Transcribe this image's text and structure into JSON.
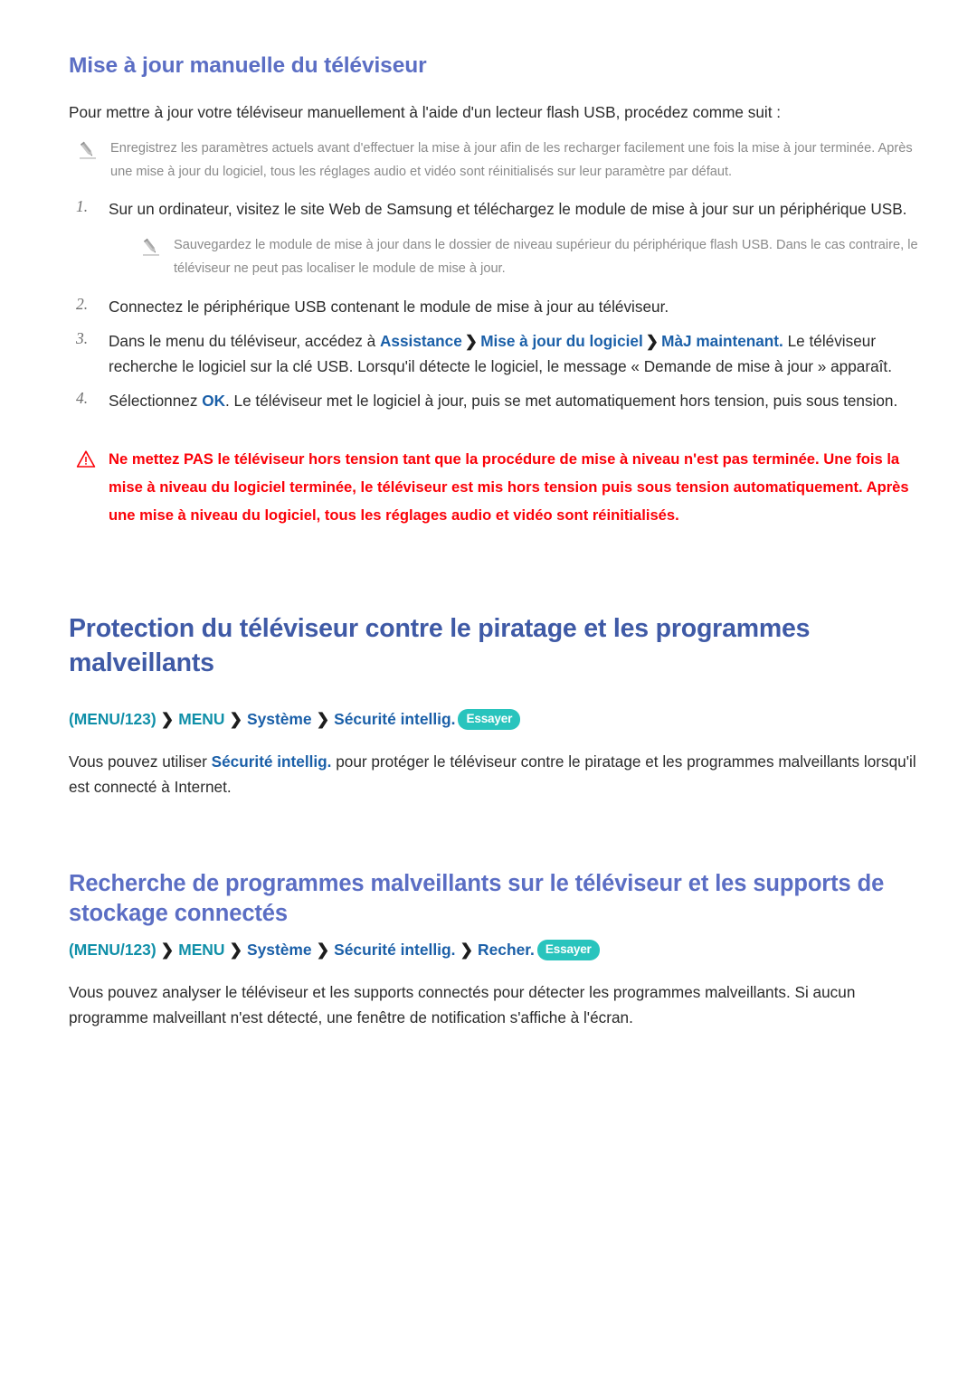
{
  "doc": {
    "title": "Mise à jour manuelle du téléviseur",
    "intro": "Pour mettre à jour votre téléviseur manuellement à l'aide d'un lecteur flash USB, procédez comme suit :",
    "note1": "Enregistrez les paramètres actuels avant d'effectuer la mise à jour afin de les recharger facilement une fois la mise à jour terminée. Après une mise à jour du logiciel, tous les réglages audio et vidéo sont réinitialisés sur leur paramètre par défaut.",
    "steps": [
      {
        "num": "1.",
        "text": "Sur un ordinateur, visitez le site Web de Samsung et téléchargez le module de mise à jour sur un périphérique USB."
      },
      {
        "num": "2.",
        "text": "Connectez le périphérique USB contenant le module de mise à jour au téléviseur."
      },
      {
        "num": "3.",
        "prefix": "Dans le menu du téléviseur, accédez à ",
        "link1": "Assistance",
        "chev1": "❯",
        "link2": "Mise à jour du logiciel",
        "chev2": "❯",
        "link3": "MàJ maintenant.",
        "suffix": " Le téléviseur recherche le logiciel sur la clé USB. Lorsqu'il détecte le logiciel, le message « Demande de mise à jour » apparaît."
      },
      {
        "num": "4.",
        "prefix": "Sélectionnez ",
        "link1": "OK",
        "suffix": ". Le téléviseur met le logiciel à jour, puis se met automatiquement hors tension, puis sous tension."
      }
    ],
    "note2": "Sauvegardez le module de mise à jour dans le dossier de niveau supérieur du périphérique flash USB. Dans le cas contraire, le téléviseur ne peut pas localiser le module de mise à jour.",
    "warning": "Ne mettez PAS le téléviseur hors tension tant que la procédure de mise à niveau n'est pas terminée. Une fois la mise à niveau du logiciel terminée, le téléviseur est mis hors tension puis sous tension automatiquement. Après une mise à niveau du logiciel, tous les réglages audio et vidéo sont réinitialisés."
  },
  "section2": {
    "title": "Protection du téléviseur contre le piratage et les programmes malveillants",
    "menupath": {
      "item1": "(MENU/123)",
      "chev1": "❯",
      "item2": "MENU",
      "chev2": "❯",
      "item3": "Système",
      "chev3": "❯",
      "item4": "Sécurité intellig.",
      "badge": "Essayer"
    },
    "body_prefix": "Vous pouvez utiliser ",
    "body_link": "Sécurité intellig.",
    "body_suffix": " pour protéger le téléviseur contre le piratage et les programmes malveillants lorsqu'il est connecté à Internet."
  },
  "section3": {
    "title": "Recherche de programmes malveillants sur le téléviseur et les supports de stockage connectés",
    "menupath": {
      "item1": "(MENU/123)",
      "chev1": "❯",
      "item2": "MENU",
      "chev2": "❯",
      "item3": "Système",
      "chev3": "❯",
      "item4": "Sécurité intellig.",
      "chev4": "❯",
      "item5": "Recher.",
      "badge": "Essayer"
    },
    "body": "Vous pouvez analyser le téléviseur et les supports connectés pour détecter les programmes malveillants. Si aucun programme malveillant n'est détecté, une fenêtre de notification s'affiche à l'écran."
  },
  "icons": {
    "note": "pencil-icon",
    "warning": "warning-triangle-icon"
  },
  "colors": {
    "heading_primary": "#5b6ec4",
    "heading_section": "#3f5aa6",
    "link": "#1a5fa8",
    "menu_teal": "#0f8fa8",
    "warning": "#fb0007",
    "badge_bg": "#29c4bd",
    "body_text": "#2b2b2b",
    "note_text": "#8a8a8a"
  }
}
